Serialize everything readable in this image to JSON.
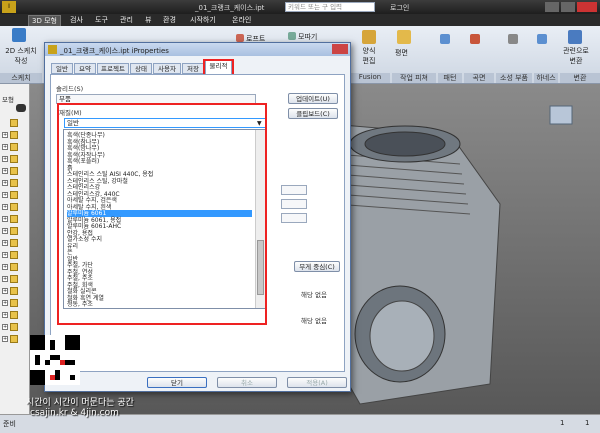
{
  "titlebar": {
    "title": "_01_크랭크_케이스.ipt",
    "search_placeholder": "키워드 또는 구 입력",
    "login": "로그인"
  },
  "menu": [
    {
      "label": "3D 모형",
      "active": true
    },
    {
      "label": "검사"
    },
    {
      "label": "도구"
    },
    {
      "label": "관리"
    },
    {
      "label": "뷰"
    },
    {
      "label": "환경"
    },
    {
      "label": "시작하기"
    },
    {
      "label": "온라인"
    }
  ],
  "ribbon": {
    "sketch_btn": "2D 스케치\n작성",
    "sketch_group": "스케치",
    "items": [
      "로프트",
      "코일",
      "모따기",
      "양식\n편집",
      "평면",
      "관련으로\n변환"
    ],
    "groups": [
      "Fusion",
      "작업 피쳐",
      "패턴",
      "곡면",
      "소성 부품",
      "하네스",
      "변환"
    ]
  },
  "browser": {
    "header": "모형",
    "root": "_01_크랭크_케이스"
  },
  "status": {
    "text": "준비",
    "right_a": "1",
    "right_b": "1"
  },
  "dialog": {
    "title": "_01_크랭크_케이스.ipt iProperties",
    "tabs": [
      "일반",
      "요약",
      "프로젝트",
      "상태",
      "사용자",
      "저장",
      "물리적"
    ],
    "active_tab": "물리적",
    "solid_label": "솔리드(S)",
    "solid_value": "부품",
    "update_btn": "업데이트(U)",
    "clipboard_btn": "클립보드(C)",
    "material_label": "재질(M)",
    "material_value": "일반",
    "materials": [
      "흑색(단종나무)",
      "흑색(참나무)",
      "흑색(밤나무)",
      "흑색(자작나무)",
      "흑색(포플러)",
      "흙",
      "스테인리스 스틸 AISI 440C, 용접",
      "스테인리스 스틸, 강마철",
      "스테인리스강",
      "스테인리스강, 440C",
      "아세탈 수지, 검은색",
      "아세탈 수지, 흰색",
      "알루미늄 6061",
      "알루미늄 6061, 용접",
      "알루미늄 6061-AHC",
      "안강, 용접",
      "열가소성 수지",
      "유리",
      "은",
      "일반",
      "주철, 가단",
      "주철, 연성",
      "주철, 주조",
      "주철, 회색",
      "철화 실리콘",
      "철화 흑연 계열",
      "청동, 주조"
    ],
    "selected_index": 12,
    "center_of_gravity_btn": "무게 중심(C)",
    "na_1": "해당 없음",
    "na_2": "해당 없음",
    "ok_btn": "닫기",
    "cancel_btn": "취소",
    "apply_btn": "적용(A)"
  },
  "watermark": {
    "line1": "시간이 시간이 머문다는 공간",
    "line2": "csajin.kr & 4jin.com"
  }
}
